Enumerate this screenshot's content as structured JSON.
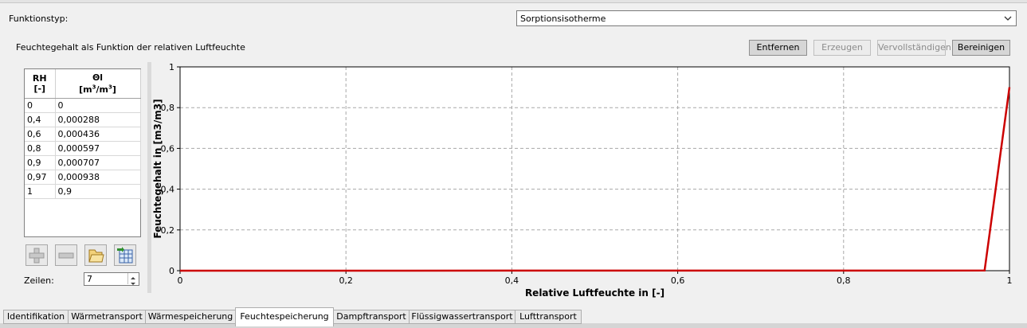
{
  "header": {
    "function_type_label": "Funktionstyp:",
    "function_type_value": "Sorptionsisotherme"
  },
  "description": "Feuchtegehalt als Funktion der relativen Luftfeuchte",
  "toolbar": {
    "remove_label": "Entfernen",
    "create_label": "Erzeugen",
    "complete_label": "Vervollständigen",
    "clean_label": "Bereinigen"
  },
  "table": {
    "col1_header": "RH",
    "col1_unit": "[-]",
    "col2_header": "Θl",
    "col2_unit_prefix": "[m",
    "col2_unit_sup1": "3",
    "col2_unit_mid": "/m",
    "col2_unit_sup2": "3",
    "col2_unit_suffix": "]",
    "rows": [
      [
        "0",
        "0"
      ],
      [
        "0,4",
        "0,000288"
      ],
      [
        "0,6",
        "0,000436"
      ],
      [
        "0,8",
        "0,000597"
      ],
      [
        "0,9",
        "0,000707"
      ],
      [
        "0,97",
        "0,000938"
      ],
      [
        "1",
        "0,9"
      ]
    ]
  },
  "rows_control": {
    "label": "Zeilen:",
    "value": "7"
  },
  "icons": [
    "plus-icon",
    "minus-icon",
    "folder-icon",
    "table-import-icon"
  ],
  "chart_data": {
    "type": "line",
    "xlabel": "Relative Luftfeuchte in [-]",
    "ylabel": "Feuchtegehalt in [m3/m3]",
    "xlim": [
      0,
      1
    ],
    "ylim": [
      0,
      1
    ],
    "xticks": [
      "0",
      "0,2",
      "0,4",
      "0,6",
      "0,8",
      "1"
    ],
    "yticks": [
      "0",
      "0,2",
      "0,4",
      "0,6",
      "0,8",
      "1"
    ],
    "grid": true,
    "series": [
      {
        "color": "#cc0000",
        "x": [
          0,
          0.4,
          0.6,
          0.8,
          0.9,
          0.97,
          1
        ],
        "y": [
          0,
          0.000288,
          0.000436,
          0.000597,
          0.000707,
          0.000938,
          0.9
        ]
      }
    ]
  },
  "tabs": [
    {
      "label": "Identifikation",
      "active": false
    },
    {
      "label": "Wärmetransport",
      "active": false
    },
    {
      "label": "Wärmespeicherung",
      "active": false
    },
    {
      "label": "Feuchtespeicherung",
      "active": true
    },
    {
      "label": "Dampftransport",
      "active": false
    },
    {
      "label": "Flüssigwassertransport",
      "active": false
    },
    {
      "label": "Lufttransport",
      "active": false
    }
  ]
}
